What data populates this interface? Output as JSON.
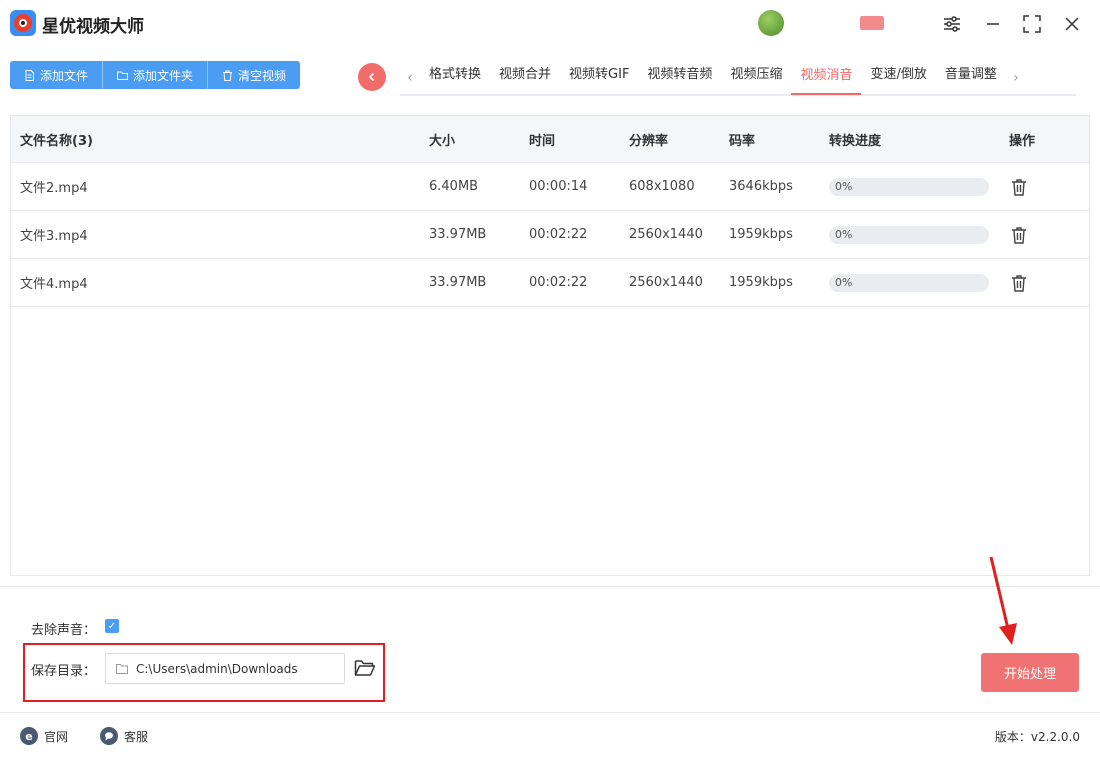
{
  "app": {
    "title": "星优视频大师",
    "user_name": ""
  },
  "toolbar": {
    "add_file": "添加文件",
    "add_folder": "添加文件夹",
    "clear": "清空视频"
  },
  "tabs": [
    {
      "label": "格式转换",
      "active": false
    },
    {
      "label": "视频合并",
      "active": false
    },
    {
      "label": "视频转GIF",
      "active": false
    },
    {
      "label": "视频转音频",
      "active": false
    },
    {
      "label": "视频压缩",
      "active": false
    },
    {
      "label": "视频消音",
      "active": true
    },
    {
      "label": "变速/倒放",
      "active": false
    },
    {
      "label": "音量调整",
      "active": false
    }
  ],
  "table": {
    "headers": {
      "name": "文件名称(3)",
      "size": "大小",
      "time": "时间",
      "resolution": "分辨率",
      "bitrate": "码率",
      "progress": "转换进度",
      "action": "操作"
    },
    "rows": [
      {
        "name": "文件2.mp4",
        "size": "6.40MB",
        "time": "00:00:14",
        "resolution": "608x1080",
        "bitrate": "3646kbps",
        "progress": "0%",
        "progress_value": 0
      },
      {
        "name": "文件3.mp4",
        "size": "33.97MB",
        "time": "00:02:22",
        "resolution": "2560x1440",
        "bitrate": "1959kbps",
        "progress": "0%",
        "progress_value": 0
      },
      {
        "name": "文件4.mp4",
        "size": "33.97MB",
        "time": "00:02:22",
        "resolution": "2560x1440",
        "bitrate": "1959kbps",
        "progress": "0%",
        "progress_value": 0
      }
    ]
  },
  "options": {
    "remove_audio_label": "去除声音：",
    "remove_audio_checked": true,
    "save_dir_label": "保存目录：",
    "save_dir_value": "C:\\Users\\admin\\Downloads"
  },
  "actions": {
    "start": "开始处理"
  },
  "footer": {
    "website": "官网",
    "support": "客服",
    "version": "版本：v2.2.0.0"
  },
  "colors": {
    "primary": "#4a9df3",
    "accent": "#f06a6a",
    "annotation": "#e02020"
  },
  "icons": [
    "file-icon",
    "folder-icon",
    "trash-icon",
    "chevron-left-icon",
    "chevron-right-icon",
    "settings-sliders-icon",
    "minimize-icon",
    "maximize-icon",
    "close-icon",
    "folder-open-icon",
    "ie-icon",
    "chat-icon"
  ]
}
